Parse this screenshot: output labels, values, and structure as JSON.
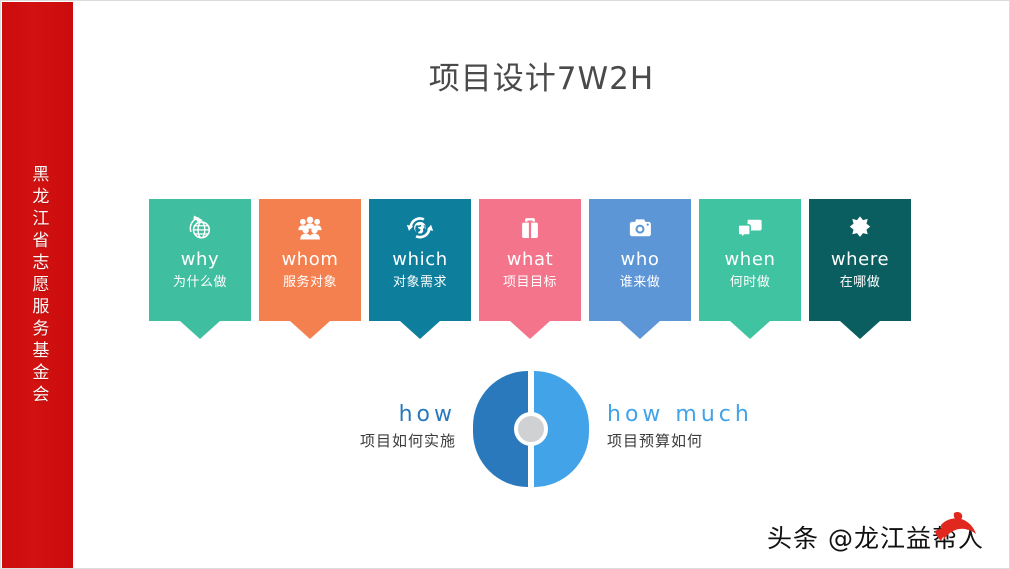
{
  "slide": {
    "title": "项目设计7W2H",
    "background_color": "#ffffff",
    "border_color": "#dcdcdc"
  },
  "side_band": {
    "text": "黑龙江省志愿服务基金会",
    "color": "#cc0c0c",
    "text_color": "#ffffff"
  },
  "cards": [
    {
      "en": "why",
      "cn": "为什么做",
      "icon": "globe-plane-icon",
      "color": "#40bfa0"
    },
    {
      "en": "whom",
      "cn": "服务对象",
      "icon": "people-group-icon",
      "color": "#f5804f"
    },
    {
      "en": "which",
      "cn": "对象需求",
      "icon": "globe-refresh-icon",
      "color": "#0d7f9c"
    },
    {
      "en": "what",
      "cn": "项目目标",
      "icon": "briefcase-icon",
      "color": "#f4748c"
    },
    {
      "en": "who",
      "cn": "谁来做",
      "icon": "camera-icon",
      "color": "#5d96d6"
    },
    {
      "en": "when",
      "cn": "何时做",
      "icon": "chat-bubbles-icon",
      "color": "#3fc3a0"
    },
    {
      "en": "where",
      "cn": "在哪做",
      "icon": "burst-star-icon",
      "color": "#0b5e60"
    }
  ],
  "pie": {
    "left_color": "#2a79bd",
    "right_color": "#43a3e8",
    "hub_color": "#cfd1d2",
    "divider_color": "#ffffff"
  },
  "how": {
    "left": {
      "en": "how",
      "cn": "项目如何实施",
      "color": "#2a79bd"
    },
    "right": {
      "en": "how much",
      "cn": "项目预算如何",
      "color": "#43a3e8"
    }
  },
  "watermark": {
    "text": "头条 @龙江益帮人",
    "mark": "bird-logo-icon",
    "mark_color": "#e0281e"
  }
}
